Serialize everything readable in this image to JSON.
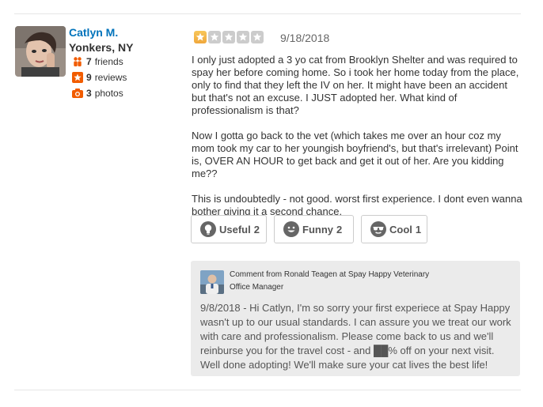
{
  "user": {
    "name": "Catlyn M.",
    "location": "Yonkers, NY",
    "friends_count": "7",
    "friends_label": "friends",
    "reviews_count": "9",
    "reviews_label": "reviews",
    "photos_count": "3",
    "photos_label": "photos"
  },
  "review": {
    "rating": 1,
    "rating_max": 5,
    "date": "9/18/2018",
    "paragraphs": [
      "I only just adopted a 3 yo cat from Brooklyn Shelter and was required to spay her before coming home. So i took her home today from the place, only to find that they left the IV on her. It might have been an accident but that's not an excuse. I JUST adopted her. What kind of professionalism is that?",
      "Now I gotta go back to the vet (which takes me over an hour coz my mom took my car to her youngish boyfriend's, but that's irrelevant) Point is, OVER AN HOUR to get back and get it out of her. Are you kidding me??",
      "This is undoubtedly - not good. worst first experience. I dont even wanna bother giving it a second chance."
    ]
  },
  "votes": {
    "useful_label": "Useful",
    "useful_count": "2",
    "funny_label": "Funny",
    "funny_count": "2",
    "cool_label": "Cool",
    "cool_count": "1"
  },
  "owner_comment": {
    "header": "Comment from Ronald Teagen at Spay Happy Veterinary",
    "role": "Office Manager",
    "text": "9/8/2018 - Hi Catlyn, I'm so sorry your first experiece at Spay Happy wasn't up to our usual standards. I can assure you we treat our work with care and professionalism. Please come back to us and we'll reinburse you for the travel cost - and ██% off on your next visit. Well done adopting! We'll make sure your cat lives the best life!"
  },
  "colors": {
    "name_link": "#0073bb",
    "star_filled": "#f0a73c",
    "star_empty": "#cccccc",
    "stat_icon": "#f15c00",
    "comment_bg": "#ebebeb"
  },
  "icons": [
    "friends-icon",
    "reviews-star-icon",
    "camera-icon",
    "lightbulb-icon",
    "smiley-icon",
    "sunglasses-icon",
    "star-icon"
  ]
}
